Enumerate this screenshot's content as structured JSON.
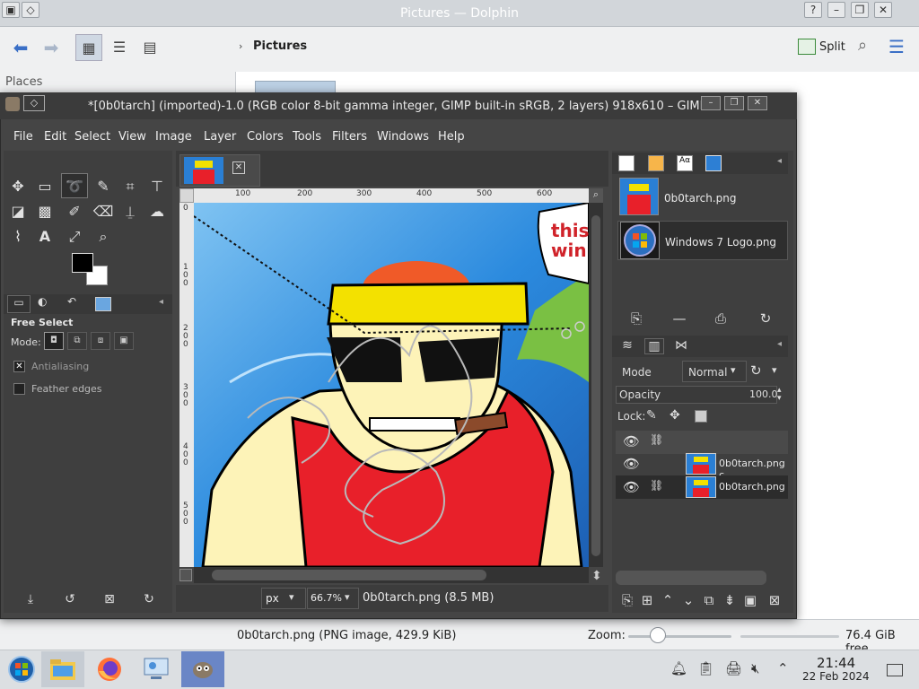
{
  "dolphin": {
    "title": "Pictures — Dolphin",
    "places_label": "Places",
    "breadcrumb": "Pictures",
    "split_label": "Split",
    "status_text": "0b0tarch.png (PNG image, 429.9 KiB)",
    "zoom_label": "Zoom:",
    "free_space": "76.4 GiB free"
  },
  "gimp": {
    "title": "*[0b0tarch] (imported)-1.0 (RGB color 8-bit gamma integer, GIMP built-in sRGB, 2 layers) 918x610 – GIMP",
    "menus": [
      "File",
      "Edit",
      "Select",
      "View",
      "Image",
      "Layer",
      "Colors",
      "Tools",
      "Filters",
      "Windows",
      "Help"
    ],
    "tool_options": {
      "title": "Free Select",
      "mode_label": "Mode:",
      "antialiasing": "Antialiasing",
      "feather_edges": "Feather edges"
    },
    "ruler_labels": [
      "100",
      "200",
      "300",
      "400",
      "500",
      "600"
    ],
    "ruler_v_labels": [
      "0",
      "1\n0\n0",
      "2\n0\n0",
      "3\n0\n0",
      "4\n0\n0",
      "5\n0\n0"
    ],
    "canvas_text": [
      "this",
      "win"
    ],
    "unit": "px",
    "zoom": "66.7%",
    "file_info": "0b0tarch.png (8.5 MB)",
    "images": [
      {
        "name": "0b0tarch.png"
      },
      {
        "name": "Windows 7 Logo.png"
      }
    ],
    "layers_panel": {
      "mode_label": "Mode",
      "mode_value": "Normal",
      "opacity_label": "Opacity",
      "opacity_value": "100.0",
      "lock_label": "Lock:",
      "layers": [
        {
          "name": "0b0tarch.png c"
        },
        {
          "name": "0b0tarch.png"
        }
      ]
    }
  },
  "taskbar": {
    "time": "21:44",
    "date": "22 Feb 2024"
  },
  "colors": {
    "gimp_bg": "#454545",
    "canvas_sky": "#2a7fd4",
    "shirt_red": "#e8202a",
    "hat_yellow": "#f3e100",
    "skin": "#fdf3b8"
  }
}
